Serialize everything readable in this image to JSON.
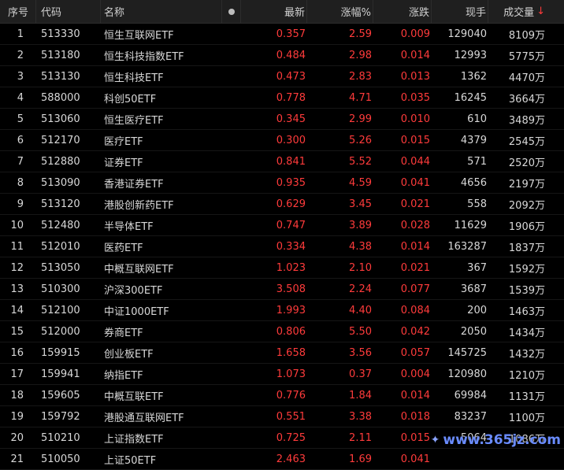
{
  "headers": {
    "idx": "序号",
    "code": "代码",
    "name": "名称",
    "last": "最新",
    "pct": "涨幅%",
    "chg": "涨跌",
    "vol": "现手",
    "amt": "成交量"
  },
  "sort_icon": "arrow-down-icon",
  "colors": {
    "up": "#ff3b3b",
    "text": "#d8d8d8",
    "bg": "#000000"
  },
  "rows": [
    {
      "idx": "1",
      "code": "513330",
      "name": "恒生互联网ETF",
      "last": "0.357",
      "pct": "2.59",
      "chg": "0.009",
      "vol": "129040",
      "amt": "8109万"
    },
    {
      "idx": "2",
      "code": "513180",
      "name": "恒生科技指数ETF",
      "last": "0.484",
      "pct": "2.98",
      "chg": "0.014",
      "vol": "12993",
      "amt": "5775万"
    },
    {
      "idx": "3",
      "code": "513130",
      "name": "恒生科技ETF",
      "last": "0.473",
      "pct": "2.83",
      "chg": "0.013",
      "vol": "1362",
      "amt": "4470万"
    },
    {
      "idx": "4",
      "code": "588000",
      "name": "科创50ETF",
      "last": "0.778",
      "pct": "4.71",
      "chg": "0.035",
      "vol": "16245",
      "amt": "3664万"
    },
    {
      "idx": "5",
      "code": "513060",
      "name": "恒生医疗ETF",
      "last": "0.345",
      "pct": "2.99",
      "chg": "0.010",
      "vol": "610",
      "amt": "3489万"
    },
    {
      "idx": "6",
      "code": "512170",
      "name": "医疗ETF",
      "last": "0.300",
      "pct": "5.26",
      "chg": "0.015",
      "vol": "4379",
      "amt": "2545万"
    },
    {
      "idx": "7",
      "code": "512880",
      "name": "证券ETF",
      "last": "0.841",
      "pct": "5.52",
      "chg": "0.044",
      "vol": "571",
      "amt": "2520万"
    },
    {
      "idx": "8",
      "code": "513090",
      "name": "香港证券ETF",
      "last": "0.935",
      "pct": "4.59",
      "chg": "0.041",
      "vol": "4656",
      "amt": "2197万"
    },
    {
      "idx": "9",
      "code": "513120",
      "name": "港股创新药ETF",
      "last": "0.629",
      "pct": "3.45",
      "chg": "0.021",
      "vol": "558",
      "amt": "2092万"
    },
    {
      "idx": "10",
      "code": "512480",
      "name": "半导体ETF",
      "last": "0.747",
      "pct": "3.89",
      "chg": "0.028",
      "vol": "11629",
      "amt": "1906万"
    },
    {
      "idx": "11",
      "code": "512010",
      "name": "医药ETF",
      "last": "0.334",
      "pct": "4.38",
      "chg": "0.014",
      "vol": "163287",
      "amt": "1837万"
    },
    {
      "idx": "12",
      "code": "513050",
      "name": "中概互联网ETF",
      "last": "1.023",
      "pct": "2.10",
      "chg": "0.021",
      "vol": "367",
      "amt": "1592万"
    },
    {
      "idx": "13",
      "code": "510300",
      "name": "沪深300ETF",
      "last": "3.508",
      "pct": "2.24",
      "chg": "0.077",
      "vol": "3687",
      "amt": "1539万"
    },
    {
      "idx": "14",
      "code": "512100",
      "name": "中证1000ETF",
      "last": "1.993",
      "pct": "4.40",
      "chg": "0.084",
      "vol": "200",
      "amt": "1463万"
    },
    {
      "idx": "15",
      "code": "512000",
      "name": "券商ETF",
      "last": "0.806",
      "pct": "5.50",
      "chg": "0.042",
      "vol": "2050",
      "amt": "1434万"
    },
    {
      "idx": "16",
      "code": "159915",
      "name": "创业板ETF",
      "last": "1.658",
      "pct": "3.56",
      "chg": "0.057",
      "vol": "145725",
      "amt": "1432万"
    },
    {
      "idx": "17",
      "code": "159941",
      "name": "纳指ETF",
      "last": "1.073",
      "pct": "0.37",
      "chg": "0.004",
      "vol": "120980",
      "amt": "1210万"
    },
    {
      "idx": "18",
      "code": "159605",
      "name": "中概互联ETF",
      "last": "0.776",
      "pct": "1.84",
      "chg": "0.014",
      "vol": "69984",
      "amt": "1131万"
    },
    {
      "idx": "19",
      "code": "159792",
      "name": "港股通互联网ETF",
      "last": "0.551",
      "pct": "3.38",
      "chg": "0.018",
      "vol": "83237",
      "amt": "1100万"
    },
    {
      "idx": "20",
      "code": "510210",
      "name": "上证指数ETF",
      "last": "0.725",
      "pct": "2.11",
      "chg": "0.015",
      "vol": "5064",
      "amt": "1086万"
    },
    {
      "idx": "21",
      "code": "510050",
      "name": "上证50ETF",
      "last": "2.463",
      "pct": "1.69",
      "chg": "0.041",
      "vol": "",
      "amt": ""
    }
  ],
  "watermark": "www.365jz.com"
}
